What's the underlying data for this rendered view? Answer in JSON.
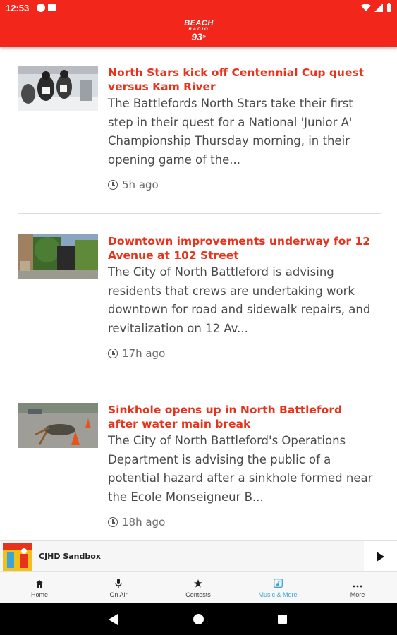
{
  "status_bar": {
    "time": "12:53"
  },
  "app": {
    "logo_line1": "BEACH",
    "logo_line2": "RADIO",
    "logo_line3": "93⁵"
  },
  "articles": [
    {
      "headline": "North Stars kick off Centennial Cup quest versus Kam River",
      "summary": "The Battlefords North Stars take their first step in their quest for a National 'Junior A' Championship Thursday morning, in their opening game of the...",
      "time": "5h ago"
    },
    {
      "headline": "Downtown improvements underway for 12 Avenue at 102 Street",
      "summary": "The City of North Battleford is advising residents that crews are undertaking work downtown for road and sidewalk repairs, and revitalization on 12 Av...",
      "time": "17h ago"
    },
    {
      "headline": "Sinkhole opens up in North Battleford after water main break",
      "summary": "The City of North Battleford's Operations Department is advising the public of a potential hazard after a sinkhole formed near the Ecole Monseigneur B...",
      "time": "18h ago"
    }
  ],
  "player": {
    "title": "CJHD Sandbox"
  },
  "bottom_nav": {
    "items": [
      {
        "label": "Home",
        "icon": "home-icon"
      },
      {
        "label": "On Air",
        "icon": "microphone-icon"
      },
      {
        "label": "Contests",
        "icon": "star-icon"
      },
      {
        "label": "Music & More",
        "icon": "music-note-icon"
      },
      {
        "label": "More",
        "icon": "more-dots-icon"
      }
    ],
    "active_index": 3
  },
  "colors": {
    "brand_red": "#f2261a",
    "headline_red": "#e8331c",
    "active_blue": "#3aa5d6"
  }
}
